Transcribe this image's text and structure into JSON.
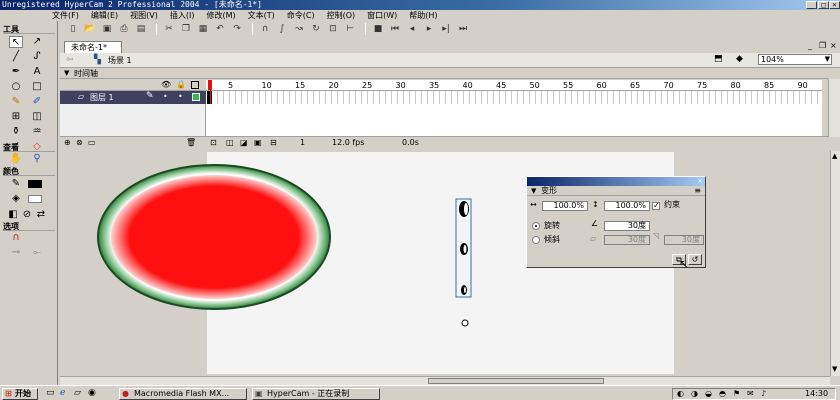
{
  "window": {
    "title": "Unregistered HyperCam 2 Professional 2004 - [未命名-1*]"
  },
  "menu": [
    "文件(F)",
    "编辑(E)",
    "视图(V)",
    "插入(I)",
    "修改(M)",
    "文本(T)",
    "命令(C)",
    "控制(O)",
    "窗口(W)",
    "帮助(H)"
  ],
  "tools_panel": {
    "title": "工具",
    "view_label": "查看",
    "colors_label": "颜色",
    "options_label": "选项"
  },
  "document": {
    "tab": "未命名-1*",
    "scene": "场景 1",
    "zoom": "104%"
  },
  "timeline": {
    "title": "时间轴",
    "frame_numbers": [
      "5",
      "10",
      "15",
      "20",
      "25",
      "30",
      "35",
      "40",
      "45",
      "50",
      "55",
      "60",
      "65",
      "70",
      "75",
      "80",
      "85",
      "90"
    ],
    "layer_name": "图层 1",
    "current_frame": "1",
    "fps": "12.0 fps",
    "time": "0.0s"
  },
  "transform_panel": {
    "title": "变形",
    "width_value": "100.0%",
    "height_value": "100.0%",
    "constrain_label": "约束",
    "rotate_label": "旋转",
    "rotate_value": "30度",
    "skew_label": "倾斜",
    "skew_h_value": "30度",
    "skew_v_value": "30度"
  },
  "taskbar": {
    "start": "开始",
    "tasks": [
      "Macromedia Flash MX...",
      "HyperCam - 正在录制"
    ],
    "clock": "14:30"
  },
  "colors": {
    "fill_red": "#ff1010",
    "ring_green": "#2e7a3a",
    "selection_blue": "#3a6ea5"
  }
}
